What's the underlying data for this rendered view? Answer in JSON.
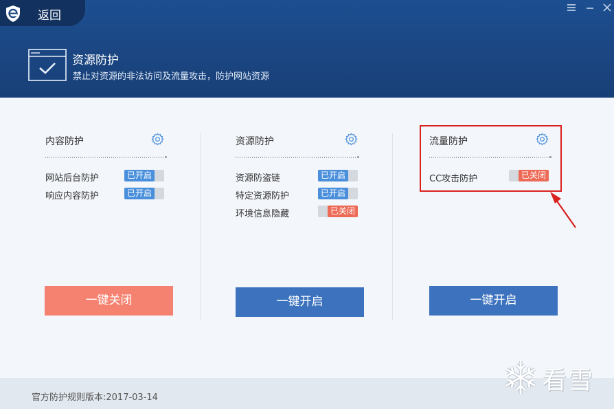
{
  "header": {
    "back_label": "返回",
    "title": "资源防护",
    "subtitle": "禁止对资源的非法访问及流量攻击，防护网站资源",
    "window_controls": [
      "menu-icon",
      "minimize-icon",
      "close-icon"
    ]
  },
  "columns": [
    {
      "title": "内容防护",
      "items": [
        {
          "label": "网站后台防护",
          "state": "已开启",
          "on": true
        },
        {
          "label": "响应内容防护",
          "state": "已开启",
          "on": true
        }
      ],
      "button": "一键关闭"
    },
    {
      "title": "资源防护",
      "items": [
        {
          "label": "资源防盗链",
          "state": "已开启",
          "on": true
        },
        {
          "label": "特定资源防护",
          "state": "已开启",
          "on": true
        },
        {
          "label": "环境信息隐藏",
          "state": "已关闭",
          "on": false
        }
      ],
      "button": "一键开启"
    },
    {
      "title": "流量防护",
      "items": [
        {
          "label": "CC攻击防护",
          "state": "已关闭",
          "on": false
        }
      ],
      "button": "一键开启"
    }
  ],
  "footer": {
    "version": "官方防护规则版本:2017-03-14"
  },
  "watermark": "看雪",
  "colors": {
    "header": "#1b4682",
    "toggle_on": "#4a8fdc",
    "toggle_off": "#ec6a56",
    "button_close": "#f58270",
    "button_open": "#3d73be",
    "highlight": "#d9211e"
  }
}
